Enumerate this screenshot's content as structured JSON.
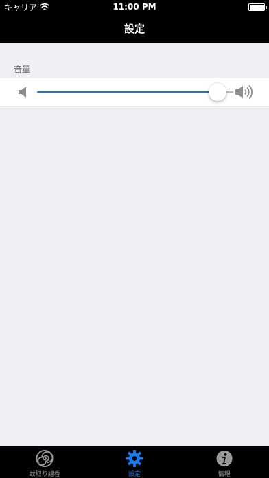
{
  "status_bar": {
    "carrier": "キャリア",
    "time": "11:00 PM"
  },
  "nav": {
    "title": "設定"
  },
  "settings": {
    "section_header": "音量",
    "volume": {
      "value": 0.92,
      "min_icon": "speaker-low-icon",
      "max_icon": "speaker-high-icon",
      "accent_color": "#1a73d6"
    }
  },
  "tabs": [
    {
      "label": "蚊取り線香",
      "icon": "spiral-icon",
      "active": false
    },
    {
      "label": "設定",
      "icon": "gear-icon",
      "active": true
    },
    {
      "label": "情報",
      "icon": "info-icon",
      "active": false
    }
  ],
  "colors": {
    "active_tab": "#1a7cf0",
    "inactive_tab": "#999999",
    "background": "#efeff4"
  }
}
